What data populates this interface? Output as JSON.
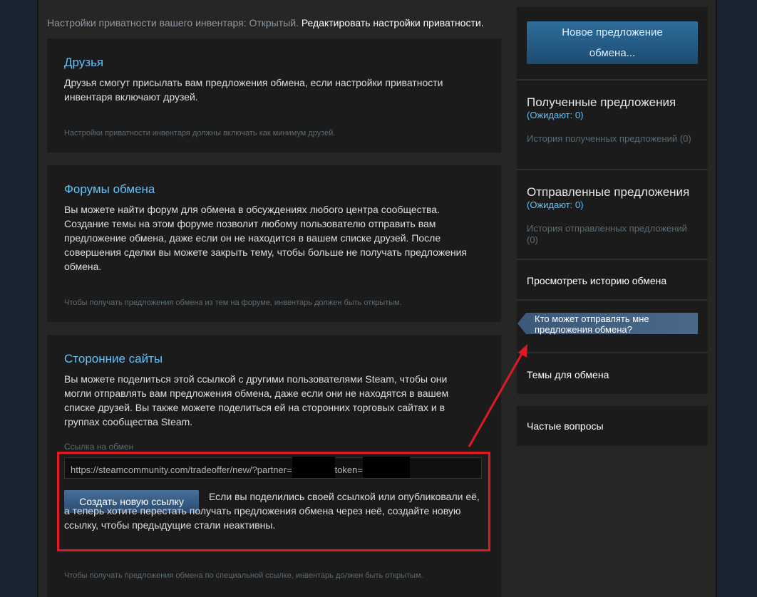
{
  "privacy": {
    "prefix": "Настройки приватности вашего инвентаря: Открытый.",
    "edit_link": "Редактировать настройки приватности."
  },
  "friends": {
    "title": "Друзья",
    "desc": "Друзья смогут присылать вам предложения обмена, если настройки приватности инвентаря включают друзей.",
    "note": "Настройки приватности инвентаря должны включать как минимум друзей."
  },
  "forums": {
    "title": "Форумы обмена",
    "desc": "Вы можете найти форум для обмена в обсуждениях любого центра сообщества. Создание темы на этом форуме позволит любому пользователю отправить вам предложение обмена, даже если он не находится в вашем списке друзей. После совершения сделки вы можете закрыть тему, чтобы больше не получать предложения обмена.",
    "note": "Чтобы получать предложения обмена из тем на форуме, инвентарь должен быть открытым."
  },
  "third_party": {
    "title": "Сторонние сайты",
    "desc": "Вы можете поделиться этой ссылкой с другими пользователями Steam, чтобы они могли отправлять вам предложения обмена, даже если они не находятся в вашем списке друзей. Вы также можете поделиться ей на сторонних торговых сайтах и в группах сообщества Steam.",
    "link_label": "Ссылка на обмен",
    "link_part1": "https://steamcommunity.com/tradeoffer/new/?partner=",
    "link_part2": "token=",
    "new_link_button": "Создать новую ссылку",
    "new_link_text": "Если вы поделились своей ссылкой или опубликовали её, а теперь хотите перестать получать предложения обмена через неё, создайте новую ссылку, чтобы предыдущие стали неактивны.",
    "note": "Чтобы получать предложения обмена по специальной ссылке, инвентарь должен быть открытым."
  },
  "sidebar": {
    "new_offer_line1": "Новое предложение",
    "new_offer_line2": "обмена...",
    "received_title": "Полученные предложения",
    "received_pending": "(Ожидают: 0)",
    "received_history": "История полученных предложений (0)",
    "sent_title": "Отправленные предложения",
    "sent_pending": "(Ожидают: 0)",
    "sent_history": "История отправленных предложений (0)",
    "view_history": "Просмотреть историю обмена",
    "who_can_send": "Кто может отправлять мне предложения обмена?",
    "trade_topics": "Темы для обмена",
    "faq": "Частые вопросы"
  },
  "colors": {
    "accent_blue": "#66c0f4",
    "annotation_red": "#e01a25"
  }
}
